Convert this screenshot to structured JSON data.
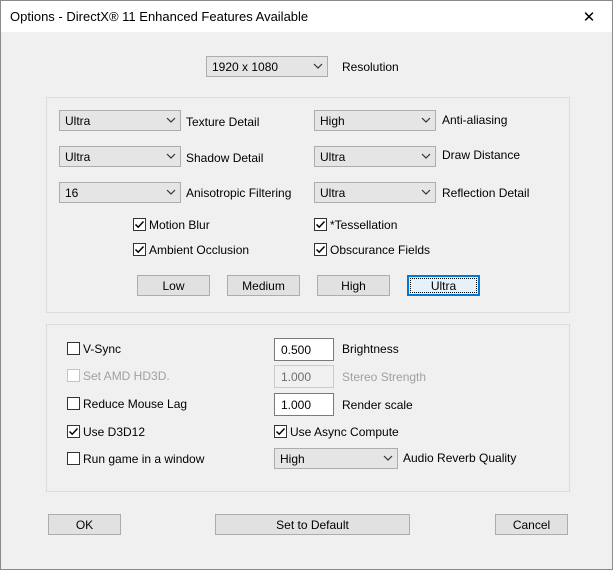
{
  "window": {
    "title": "Options - DirectX® 11 Enhanced Features Available",
    "close_glyph": "✕"
  },
  "resolution": {
    "value": "1920 x 1080",
    "label": "Resolution"
  },
  "graphics": {
    "texture_detail": {
      "value": "Ultra",
      "label": "Texture Detail"
    },
    "shadow_detail": {
      "value": "Ultra",
      "label": "Shadow Detail"
    },
    "anisotropic": {
      "value": "16",
      "label": "Anisotropic Filtering"
    },
    "anti_aliasing": {
      "value": "High",
      "label": "Anti-aliasing"
    },
    "draw_distance": {
      "value": "Ultra",
      "label": "Draw Distance"
    },
    "reflection_detail": {
      "value": "Ultra",
      "label": "Reflection Detail"
    },
    "motion_blur": {
      "label": "Motion Blur",
      "checked": true
    },
    "ambient_occlusion": {
      "label": "Ambient Occlusion",
      "checked": true
    },
    "tessellation": {
      "label": "*Tessellation",
      "checked": true
    },
    "obscurance_fields": {
      "label": "Obscurance Fields",
      "checked": true
    },
    "presets": {
      "low": "Low",
      "medium": "Medium",
      "high": "High",
      "ultra": "Ultra"
    }
  },
  "advanced": {
    "vsync": {
      "label": "V-Sync",
      "checked": false
    },
    "amd_hd3d": {
      "label": "Set AMD HD3D.",
      "checked": false,
      "enabled": false
    },
    "reduce_mouse_lag": {
      "label": "Reduce Mouse Lag",
      "checked": false
    },
    "use_d3d12": {
      "label": "Use D3D12",
      "checked": true
    },
    "run_in_window": {
      "label": "Run game in a window",
      "checked": false
    },
    "brightness": {
      "value": "0.500",
      "label": "Brightness"
    },
    "stereo_strength": {
      "value": "1.000",
      "label": "Stereo Strength",
      "enabled": false
    },
    "render_scale": {
      "value": "1.000",
      "label": "Render scale"
    },
    "async_compute": {
      "label": "Use Async Compute",
      "checked": true
    },
    "audio_reverb": {
      "value": "High",
      "label": "Audio Reverb Quality"
    }
  },
  "footer": {
    "ok": "OK",
    "set_default": "Set to Default",
    "cancel": "Cancel"
  },
  "icons": {
    "check": "check-icon",
    "chevron": "chevron-down-icon",
    "close": "close-icon"
  },
  "colors": {
    "focus_border": "#0078d7",
    "disabled_text": "#a0a0a0"
  }
}
